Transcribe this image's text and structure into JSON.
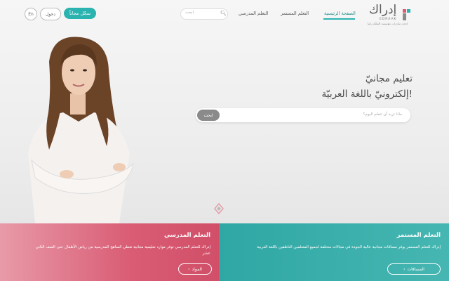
{
  "header": {
    "lang": "En",
    "login": "دخول",
    "signup": "سجّل مجاناً",
    "search_placeholder": "ابحث",
    "nav": [
      "الصفحة الرئيسية",
      "التعلم المستمر",
      "التعلم المدرسي"
    ],
    "logo_text": "إدراك",
    "logo_latin": "EDRAAK",
    "logo_tag": "إحدى مبادرات مؤسسة الملكة رانيا"
  },
  "hero": {
    "title_line1": "تعليم مجانيّ",
    "title_line2": "إلكترونيّ باللغة العربيّة!",
    "search_placeholder": "ماذا تريد أن تتعلم اليوم؟",
    "search_button": "ابحث"
  },
  "panels": {
    "school": {
      "title": "التعلم المدرسي",
      "text": "إدراك للتعلم المدرسي توفر موارد تعليمية مجانية تغطي المناهج المدرسية من رياض الأطفال حتى الصف الثاني عشر",
      "button": "المواد"
    },
    "continuing": {
      "title": "التعلم المستمر",
      "text": "إدراك للتعلم المستمر يوفر مساقات مجانية عالية الجودة في مجالات مختلفة لجميع المتعلمين الناطقين باللغة العربية",
      "button": "المساقات"
    }
  },
  "colors": {
    "teal": "#2bb3b0",
    "pink": "#d95c74"
  }
}
